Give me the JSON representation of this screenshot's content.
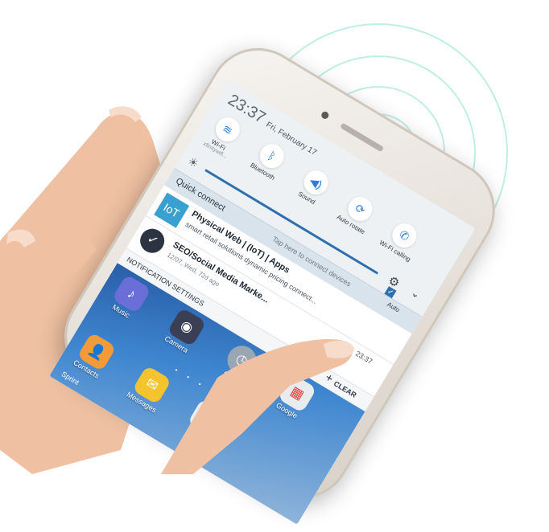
{
  "colors": {
    "accent": "#2e6fb0",
    "ring": "#bfeee3",
    "skin": "#f0c4a6",
    "screen_bg": "#eef1f4"
  },
  "status": {
    "time": "23:37",
    "date": "Fri, February 17"
  },
  "toggles": [
    {
      "icon": "wifi-icon",
      "label": "Wi-Fi",
      "sub": "xfinitywifi..."
    },
    {
      "icon": "bluetooth-icon",
      "label": "Bluetooth",
      "sub": ""
    },
    {
      "icon": "sound-icon",
      "label": "Sound",
      "sub": ""
    },
    {
      "icon": "auto-rotate-icon",
      "label": "Auto rotate",
      "sub": ""
    },
    {
      "icon": "wifi-calling-icon",
      "label": "Wi-Fi calling",
      "sub": ""
    }
  ],
  "quick_connect": {
    "title": "Quick connect",
    "hint": "Tap here to connect devices",
    "auto": "Auto"
  },
  "notifications": [
    {
      "badge": "IoT",
      "title": "Physical Web | (IoT) | Apps",
      "body": "smart retail solutions dynamic pricing connect...",
      "time": ""
    },
    {
      "badge": "✓",
      "title": "SEO/Social Media Marke...",
      "meta": "12/07, Wed, 72d ago",
      "time": "23:37"
    }
  ],
  "notif_actions": {
    "settings": "NOTIFICATION SETTINGS",
    "clear": "CLEAR"
  },
  "apps": [
    {
      "icon": "music-icon",
      "label": "Music",
      "color": "#6a6fd8"
    },
    {
      "icon": "camera-icon",
      "label": "Camera",
      "color": "#3b3f55"
    },
    {
      "icon": "clock-icon",
      "label": "Clock",
      "color": "#9aa6b2"
    },
    {
      "icon": "google-icon",
      "label": "Google",
      "color": "#e8ecef"
    },
    {
      "icon": "contacts-icon",
      "label": "Contacts",
      "color": "#f29b38"
    },
    {
      "icon": "messages-icon",
      "label": "Messages",
      "color": "#f4c32e"
    },
    {
      "icon": "apps-icon",
      "label": "Apps",
      "color": "#e9eef2"
    }
  ],
  "carrier": "Sprint"
}
